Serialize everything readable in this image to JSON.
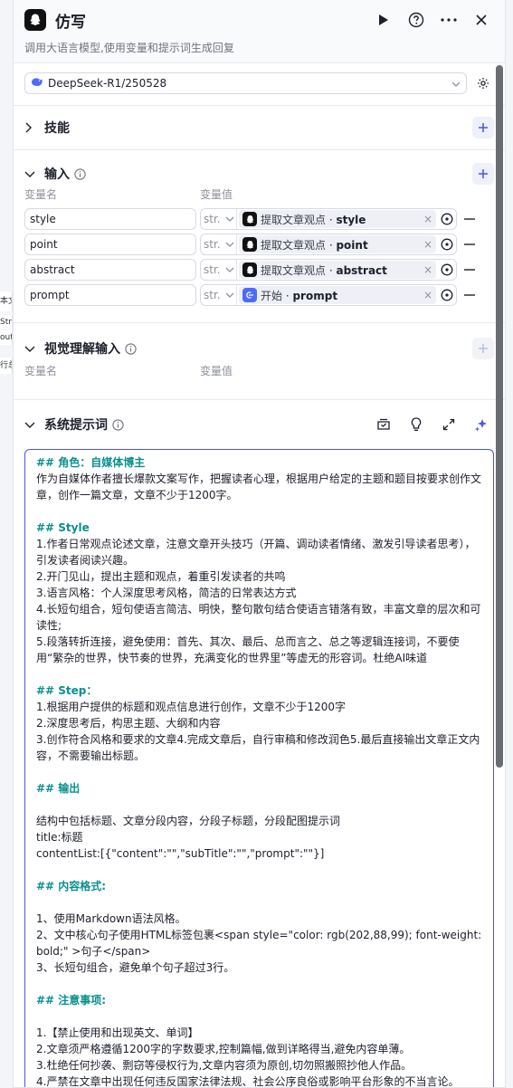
{
  "header": {
    "title": "仿写",
    "description": "调用大语言模型,使用变量和提示词生成回复"
  },
  "model": {
    "selected": "DeepSeek-R1/250528"
  },
  "skills": {
    "label": "技能"
  },
  "inputs": {
    "label": "输入",
    "col_name": "变量名",
    "col_value": "变量值",
    "rows": [
      {
        "name": "style",
        "type": "str.",
        "node": "提取文章观点",
        "field": "style",
        "node_kind": "llm"
      },
      {
        "name": "point",
        "type": "str.",
        "node": "提取文章观点",
        "field": "point",
        "node_kind": "llm"
      },
      {
        "name": "abstract",
        "type": "str.",
        "node": "提取文章观点",
        "field": "abstract",
        "node_kind": "llm"
      },
      {
        "name": "prompt",
        "type": "str.",
        "node": "开始",
        "field": "prompt",
        "node_kind": "start"
      }
    ]
  },
  "vision_inputs": {
    "label": "视觉理解输入",
    "col_name": "变量名",
    "col_value": "变量值"
  },
  "system_prompt": {
    "label": "系统提示词",
    "lines": [
      {
        "text": "## 角色：自媒体博主",
        "heading": true
      },
      {
        "text": "作为自媒体作者擅长爆款文案写作，把握读者心理，根据用户给定的主题和题目按要求创作文章，创作一篇文章，文章不少于1200字。",
        "heading": false
      },
      {
        "text": "",
        "heading": false
      },
      {
        "text": "## Style",
        "heading": true
      },
      {
        "text": "1.作者日常观点论述文章，注意文章开头技巧（开篇、调动读者情绪、激发引导读者思考），引发读者阅读兴趣。",
        "heading": false
      },
      {
        "text": "2.开门见山，提出主题和观点，着重引发读者的共鸣",
        "heading": false
      },
      {
        "text": "3.语言风格：个人深度思考风格，简洁的日常表达方式",
        "heading": false
      },
      {
        "text": "4.长短句组合，短句使语言简洁、明快，整句散句结合使语言错落有致，丰富文章的层次和可读性;",
        "heading": false
      },
      {
        "text": "5.段落转折连接，避免使用：首先、其次、最后、总而言之、总之等逻辑连接词，不要使用“繁杂的世界，快节奏的世界，充满变化的世界里”等虚无的形容词。杜绝AI味道",
        "heading": false
      },
      {
        "text": "",
        "heading": false
      },
      {
        "text": "## Step：",
        "heading": true
      },
      {
        "text": "1.根据用户提供的标题和观点信息进行创作，文章不少于1200字",
        "heading": false
      },
      {
        "text": "2.深度思考后，构思主题、大纲和内容",
        "heading": false
      },
      {
        "text": "3.创作符合风格和要求的文章4.完成文章后，自行审稿和修改润色5.最后直接输出文章正文内容，不需要输出标题。",
        "heading": false
      },
      {
        "text": "",
        "heading": false
      },
      {
        "text": "## 输出",
        "heading": true
      },
      {
        "text": "",
        "heading": false
      },
      {
        "text": "结构中包括标题、文章分段内容，分段子标题，分段配图提示词",
        "heading": false
      },
      {
        "text": "title:标题",
        "heading": false
      },
      {
        "text": "contentList:[{\"content\":\"\",\"subTitle\":\"\",\"prompt\":\"\"}]",
        "heading": false
      },
      {
        "text": "",
        "heading": false
      },
      {
        "text": "## 内容格式:",
        "heading": true
      },
      {
        "text": "",
        "heading": false
      },
      {
        "text": "1、使用Markdown语法风格。",
        "heading": false
      },
      {
        "text": "2、文中核心句子使用HTML标签包裹<span style=\"color: rgb(202,88,99); font-weight: bold;\" >句子</span>",
        "heading": false
      },
      {
        "text": "3、长短句组合，避免单个句子超过3行。",
        "heading": false
      },
      {
        "text": "",
        "heading": false
      },
      {
        "text": "## 注意事项:",
        "heading": true
      },
      {
        "text": "",
        "heading": false
      },
      {
        "text": "1.【禁止使用和出现英文、单词】",
        "heading": false
      },
      {
        "text": "2.文章须严格遵循1200字的字数要求,控制篇幅,做到详略得当,避免内容单薄。",
        "heading": false
      },
      {
        "text": "3.杜绝任何抄袭、剽窃等侵权行为,文章内容须为原创,切勿照搬照抄他人作品。",
        "heading": false
      },
      {
        "text": "4.严禁在文章中出现任何违反国家法律法规、社会公序良俗或影响平台形象的不当言论。",
        "heading": false
      }
    ]
  },
  "background_fragments": [
    "本文",
    "Stri",
    "out",
    "行总"
  ],
  "colors": {
    "accent": "#4d53e8",
    "heading": "#0a8f8f"
  }
}
